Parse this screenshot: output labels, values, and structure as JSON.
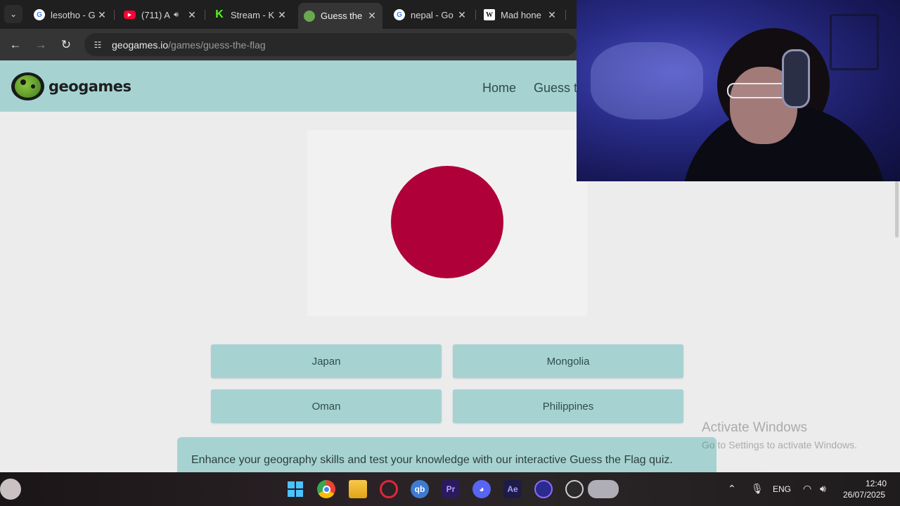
{
  "browser": {
    "tabs": [
      {
        "title": "lesotho - G",
        "favicon": "google-icon",
        "active": false
      },
      {
        "title": "(711) A",
        "favicon": "youtube-icon",
        "active": false,
        "audio": true
      },
      {
        "title": "Stream - K",
        "favicon": "kick-icon",
        "active": false
      },
      {
        "title": "Guess the",
        "favicon": "geogames-icon",
        "active": true
      },
      {
        "title": "nepal - Go",
        "favicon": "google-icon",
        "active": false
      },
      {
        "title": "Mad hone",
        "favicon": "wikipedia-icon",
        "active": false
      }
    ],
    "url_host": "geogames.io",
    "url_path": "/games/guess-the-flag"
  },
  "site": {
    "logo_text": "geogames",
    "nav": {
      "home": "Home",
      "guess": "Guess t"
    }
  },
  "quiz": {
    "flag": {
      "background": "#f1f1f1",
      "disc_color": "#b0003a"
    },
    "answers": [
      "Japan",
      "Mongolia",
      "Oman",
      "Philippines"
    ],
    "description": "Enhance your geography skills and test your knowledge with our interactive Guess the Flag quiz."
  },
  "watermark": {
    "title": "Activate Windows",
    "subtitle": "Go to Settings to activate Windows."
  },
  "taskbar": {
    "apps": [
      "windows-start-icon",
      "chrome-icon",
      "file-explorer-icon",
      "opera-gx-icon",
      "qbittorrent-icon",
      "premiere-pro-icon",
      "discord-icon",
      "after-effects-icon",
      "obs-icon",
      "steam-icon"
    ],
    "app_labels": {
      "premiere": "Pr",
      "after_effects": "Ae",
      "qbittorrent": "qb"
    },
    "language": "ENG",
    "time": "12:40",
    "date": "26/07/2025"
  },
  "colors": {
    "accent": "#a6d3d1",
    "page_bg": "#ececec",
    "flag_red": "#b0003a"
  }
}
